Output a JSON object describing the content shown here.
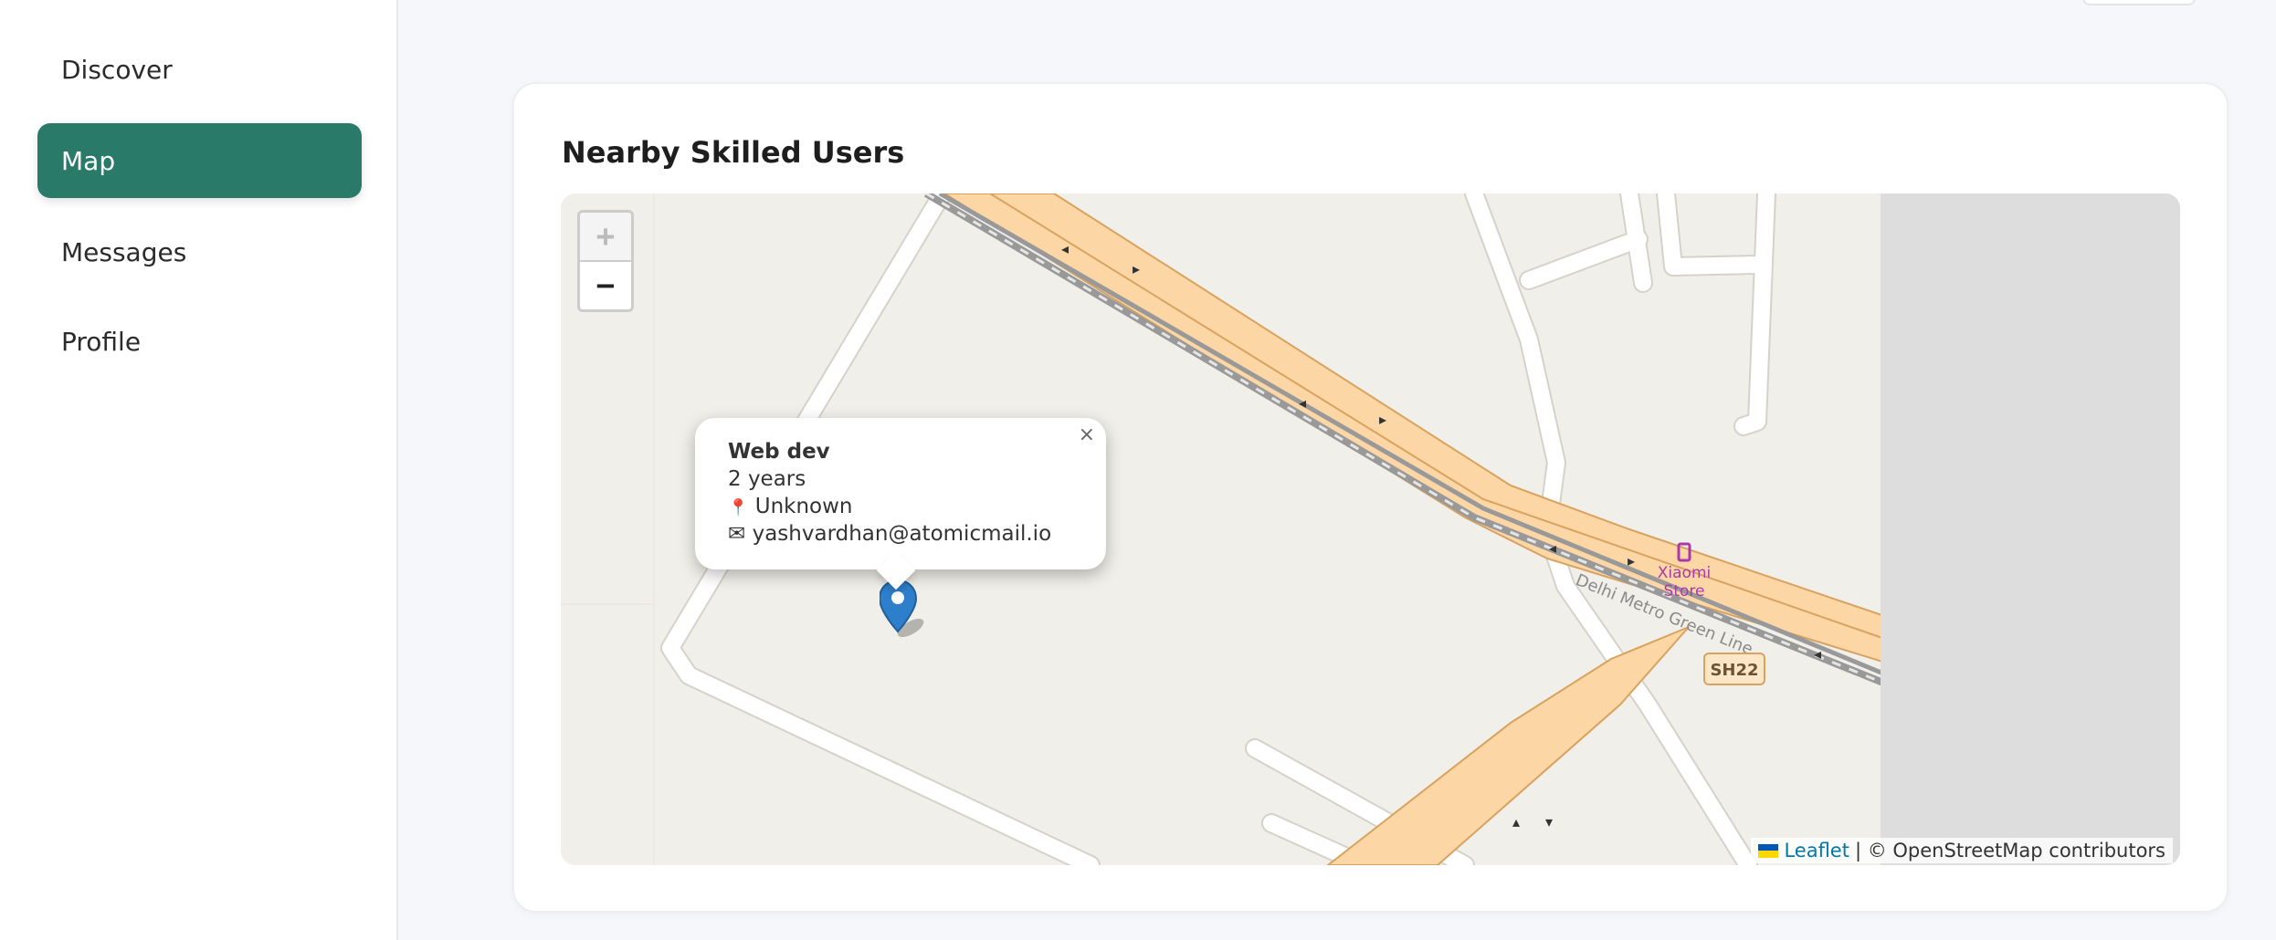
{
  "sidebar": {
    "items": [
      {
        "label": "Discover",
        "active": false
      },
      {
        "label": "Map",
        "active": true
      },
      {
        "label": "Messages",
        "active": false
      },
      {
        "label": "Profile",
        "active": false
      }
    ]
  },
  "card": {
    "title": "Nearby Skilled Users"
  },
  "map": {
    "zoom_in": "+",
    "zoom_out": "−",
    "labels": {
      "poi": "Xiaomi",
      "poi_line2": "Store",
      "rail": "Delhi Metro Green Line",
      "road_shield": "SH22"
    },
    "popup": {
      "skill": "Web dev",
      "experience": "2 years",
      "location_icon": "📍",
      "location": "Unknown",
      "email_icon": "✉",
      "email": "yashvardhan@atomicmail.io",
      "close": "×"
    },
    "attribution": {
      "leaflet": "Leaflet",
      "rest": "| © OpenStreetMap contributors"
    },
    "colors": {
      "road_fill": "#fcd6a4",
      "road_edge": "#d9a25e",
      "land": "#f1efe9",
      "marker": "#2e7fcb"
    }
  },
  "colors": {
    "accent": "#2a7a6a"
  }
}
